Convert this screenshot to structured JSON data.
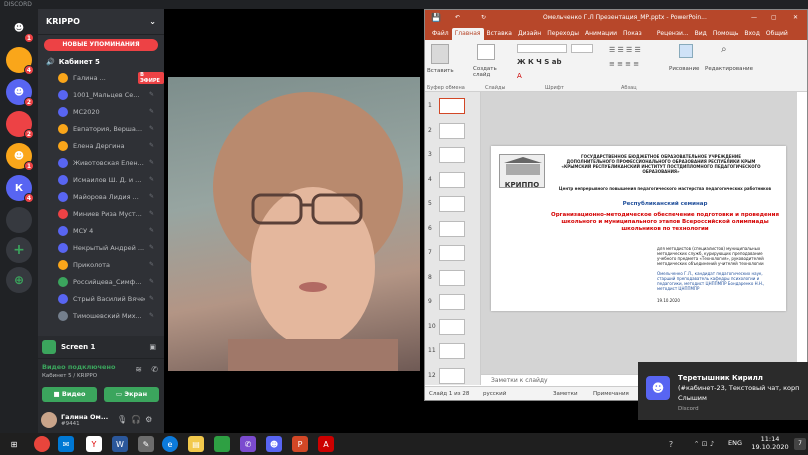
{
  "window": {
    "title": "DISCORD"
  },
  "servers": [
    {
      "label": "",
      "badge": "1",
      "color": "#5865f2"
    },
    {
      "label": "",
      "badge": "4",
      "color": "#faa61a"
    },
    {
      "label": "",
      "badge": "2",
      "color": "#5865f2"
    },
    {
      "label": "",
      "badge": "2",
      "color": "#ed4245"
    },
    {
      "label": "",
      "badge": "1",
      "color": "#faa61a"
    },
    {
      "label": "К",
      "badge": "4",
      "color": "#5865f2"
    },
    {
      "label": "",
      "badge": "",
      "color": "#36393f"
    }
  ],
  "server_actions": {
    "add": "+",
    "explore": "⊕"
  },
  "guild": {
    "name": "KRIPPO",
    "chevron": "⌄"
  },
  "mentions_label": "НОВЫЕ УПОМИНАНИЯ",
  "voice_channel": {
    "name": "Кабинет 5"
  },
  "members": [
    {
      "name": "Галина ...",
      "live": "В ЭФИРЕ",
      "color": "#faa61a"
    },
    {
      "name": "1001_Мальцев Се...",
      "color": "#5865f2"
    },
    {
      "name": "МС2020",
      "color": "#5865f2"
    },
    {
      "name": "Евпатория, Верша...",
      "color": "#faa61a"
    },
    {
      "name": "Елена Дергина",
      "color": "#faa61a"
    },
    {
      "name": "Животовская Елен...",
      "color": "#5865f2"
    },
    {
      "name": "Исмаилов Ш. Д. и ...",
      "color": "#5865f2"
    },
    {
      "name": "Майорова Лидия ...",
      "color": "#5865f2"
    },
    {
      "name": "Миниев Риза Муст...",
      "color": "#ed4245"
    },
    {
      "name": "МСУ 4",
      "color": "#5865f2"
    },
    {
      "name": "Некрытый Андрей ...",
      "color": "#5865f2"
    },
    {
      "name": "Приколота",
      "color": "#faa61a"
    },
    {
      "name": "Российцева_Симф...",
      "color": "#3ba55d"
    },
    {
      "name": "Стрый Василий Вячесл...",
      "color": "#5865f2"
    },
    {
      "name": "Тимошевский Мих...",
      "color": "#747f8d"
    }
  ],
  "stream": {
    "label": "Screen 1"
  },
  "voice": {
    "status": "Видео подключено",
    "location": "Кабинет 5 / KRIPPO",
    "video_button": "Видео",
    "screen_button": "Экран"
  },
  "user": {
    "name": "Галина Ом...",
    "tag": "#9441"
  },
  "powerpoint": {
    "title": "Омельченко Г.Л Презентация_МР.pptx - PowerPoin...",
    "tabs": [
      "Файл",
      "Главная",
      "Вставка",
      "Дизайн",
      "Переходы",
      "Анимации",
      "Показ сл...",
      "Рецензи...",
      "Вид",
      "Помощь",
      "Вход",
      "Общий доступ"
    ],
    "ribbon": {
      "paste": "Вставить",
      "create_slide": "Создать слайд",
      "drawing": "Рисование",
      "editing": "Редактирование",
      "groups": [
        "Буфер обмена",
        "Слайды",
        "Шрифт",
        "Абзац"
      ]
    },
    "slide_numbers": [
      "1",
      "2",
      "3",
      "4",
      "5",
      "6",
      "7",
      "8",
      "9",
      "10",
      "11",
      "12"
    ],
    "slide": {
      "org": "ГОСУДАРСТВЕННОЕ БЮДЖЕТНОЕ ОБРАЗОВАТЕЛЬНОЕ УЧРЕЖДЕНИЕ ДОПОЛНИТЕЛЬНОГО ПРОФЕССИОНАЛЬНОГО ОБРАЗОВАНИЯ РЕСПУБЛИКИ КРЫМ «КРЫМСКИЙ РЕСПУБЛИКАНСКИЙ ИНСТИТУТ ПОСТДИПЛОМНОГО ПЕДАГОГИЧЕСКОГО ОБРАЗОВАНИЯ»",
      "logo": "КРИППО",
      "center": "Центр непрерывного повышения педагогического мастерства педагогических работников",
      "seminar": "Республиканский семинар",
      "topic": "Организационно-методическое обеспечение подготовки и проведения школьного и муниципального этапов Всероссийской олимпиады школьников по технологии",
      "audience": "для методистов (специалистов) муниципальных методических служб, курирующих преподавание учебного предмета «Технология», руководителей методических объединений учителей технологии",
      "authors": "Омельченко Г.Л., кандидат педагогических наук, старший преподаватель кафедры психологии и педагогики, методист ЦНППМПР Бондаренко Н.Н., методист ЦНППМПР",
      "date": "19.10.2020"
    },
    "notes_placeholder": "Заметки к слайду",
    "status": {
      "slide": "Слайд 1 из 28",
      "lang": "русский",
      "notes": "Заметки",
      "comments": "Примечания"
    }
  },
  "notification": {
    "title": "Теретышник Кирилл",
    "line": "(#кабинет-23, Текстовый чат, корп",
    "body": "Слышим",
    "app": "Discord"
  },
  "taskbar": {
    "lang": "ENG",
    "time": "11:14",
    "date": "19.10.2020",
    "notif_count": "7"
  }
}
